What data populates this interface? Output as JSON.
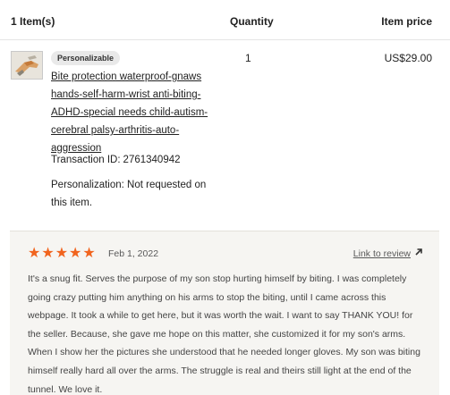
{
  "header": {
    "items_label": "1 Item(s)",
    "quantity_label": "Quantity",
    "price_label": "Item price"
  },
  "item": {
    "thumbnail_icon": "product-thumbnail-gloves",
    "badge": "Personalizable",
    "title": "Bite protection waterproof-gnaws hands-self-harm-wrist anti-biting-ADHD-special needs child-autism-cerebral palsy-arthritis-auto-aggression",
    "transaction_label": "Transaction ID:",
    "transaction_id": "2761340942",
    "personalization": "Personalization: Not requested on this item.",
    "quantity": "1",
    "price": "US$29.00"
  },
  "review": {
    "rating": 5,
    "star_color": "#f1641e",
    "stars": [
      "★",
      "★",
      "★",
      "★",
      "★"
    ],
    "date": "Feb 1, 2022",
    "link_label": "Link to review",
    "link_icon": "arrow-up-right-icon",
    "text": "It's a snug fit. Serves the purpose of my son stop hurting himself by biting. I was completely going crazy putting him anything on his arms to stop the biting, until I came across this webpage. It took a while to get here, but it was worth the wait. I want to say THANK YOU! for the seller. Because, she gave me hope on this matter, she customized it for my son's arms. When I show her the pictures she understood that he needed longer gloves. My son was biting himself really hard all over the arms. The struggle is real and theirs still light at the end of the tunnel. We love it."
  }
}
